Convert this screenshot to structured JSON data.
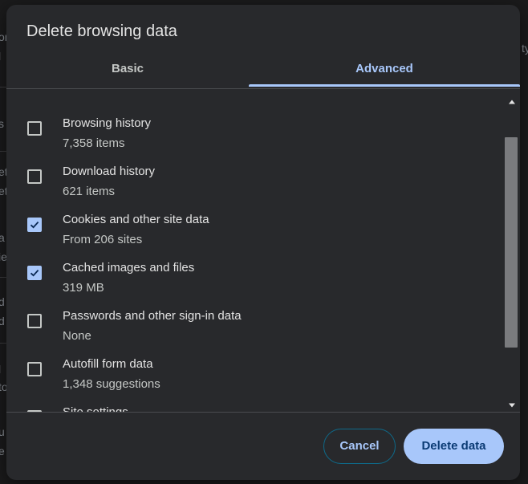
{
  "backdrop": {
    "fragments": [
      "on",
      "l",
      "s",
      "et",
      "et",
      "a",
      "ie",
      "d",
      "d",
      "l",
      "to",
      "u",
      "e",
      "ty"
    ]
  },
  "dialog": {
    "title": "Delete browsing data",
    "tabs": [
      {
        "label": "Basic",
        "selected": false
      },
      {
        "label": "Advanced",
        "selected": true
      }
    ],
    "items": [
      {
        "label": "Browsing history",
        "detail": "7,358 items",
        "checked": false
      },
      {
        "label": "Download history",
        "detail": "621 items",
        "checked": false
      },
      {
        "label": "Cookies and other site data",
        "detail": "From 206 sites",
        "checked": true
      },
      {
        "label": "Cached images and files",
        "detail": "319 MB",
        "checked": true
      },
      {
        "label": "Passwords and other sign-in data",
        "detail": "None",
        "checked": false
      },
      {
        "label": "Autofill form data",
        "detail": "1,348 suggestions",
        "checked": false
      },
      {
        "label": "Site settings",
        "detail": "",
        "checked": false
      }
    ],
    "buttons": {
      "cancel": "Cancel",
      "delete": "Delete data"
    }
  },
  "colors": {
    "accent": "#a8c7fa",
    "dialog_background": "#28292c",
    "delete_text": "#0b3b74"
  },
  "icons": {
    "checkbox_checked": "checkmark-icon",
    "scroll_up": "triangle-up-icon",
    "scroll_down": "triangle-down-icon"
  }
}
